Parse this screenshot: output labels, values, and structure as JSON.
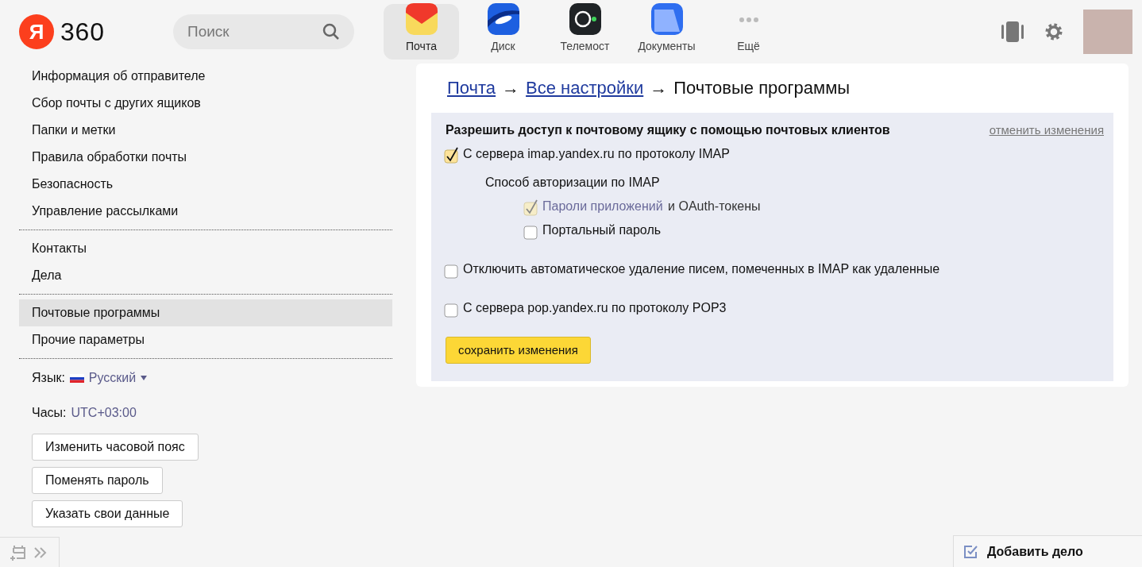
{
  "header": {
    "logo_letter": "Я",
    "logo_text": "360",
    "search": {
      "placeholder": "Поиск"
    },
    "apps": [
      {
        "kind": "mail",
        "label": "Почта",
        "selected": true
      },
      {
        "kind": "disk",
        "label": "Диск",
        "selected": false
      },
      {
        "kind": "telemost",
        "label": "Телемост",
        "selected": false
      },
      {
        "kind": "docs",
        "label": "Документы",
        "selected": false
      },
      {
        "kind": "more",
        "label": "Ещё",
        "selected": false
      }
    ]
  },
  "sidebar": {
    "groups": [
      [
        {
          "label": "Информация об отправителе",
          "selected": false
        },
        {
          "label": "Сбор почты с других ящиков",
          "selected": false
        },
        {
          "label": "Папки и метки",
          "selected": false
        },
        {
          "label": "Правила обработки почты",
          "selected": false
        },
        {
          "label": "Безопасность",
          "selected": false
        },
        {
          "label": "Управление рассылками",
          "selected": false
        }
      ],
      [
        {
          "label": "Контакты",
          "selected": false
        },
        {
          "label": "Дела",
          "selected": false
        }
      ],
      [
        {
          "label": "Почтовые программы",
          "selected": true
        },
        {
          "label": "Прочие параметры",
          "selected": false
        }
      ]
    ],
    "language": {
      "label": "Язык:",
      "value": "Русский"
    },
    "clock": {
      "label": "Часы:",
      "value": "UTC+03:00"
    },
    "buttons": [
      "Изменить часовой пояс",
      "Поменять пароль",
      "Указать свои данные"
    ]
  },
  "breadcrumb": {
    "links": [
      "Почта",
      "Все настройки"
    ],
    "separator": "→",
    "current": "Почтовые программы"
  },
  "panel": {
    "title": "Разрешить доступ к почтовому ящику с помощью почтовых клиентов",
    "cancel_link": "отменить изменения",
    "options": [
      {
        "label": "С сервера imap.yandex.ru по протоколу IMAP",
        "checked": true,
        "sub_heading": "Способ авторизации по IMAP",
        "children": [
          {
            "link": "Пароли приложений",
            "label": " и OAuth-токены",
            "checked": true,
            "disabled": true
          },
          {
            "label": "Портальный пароль",
            "checked": false,
            "disabled": false
          }
        ]
      },
      {
        "label": "Отключить автоматическое удаление писем, помеченных в IMAP как удаленные",
        "checked": false
      },
      {
        "label": "С сервера pop.yandex.ru по протоколу POP3",
        "checked": false
      }
    ],
    "save_button": "сохранить изменения"
  },
  "todo_button": "Добавить дело"
}
